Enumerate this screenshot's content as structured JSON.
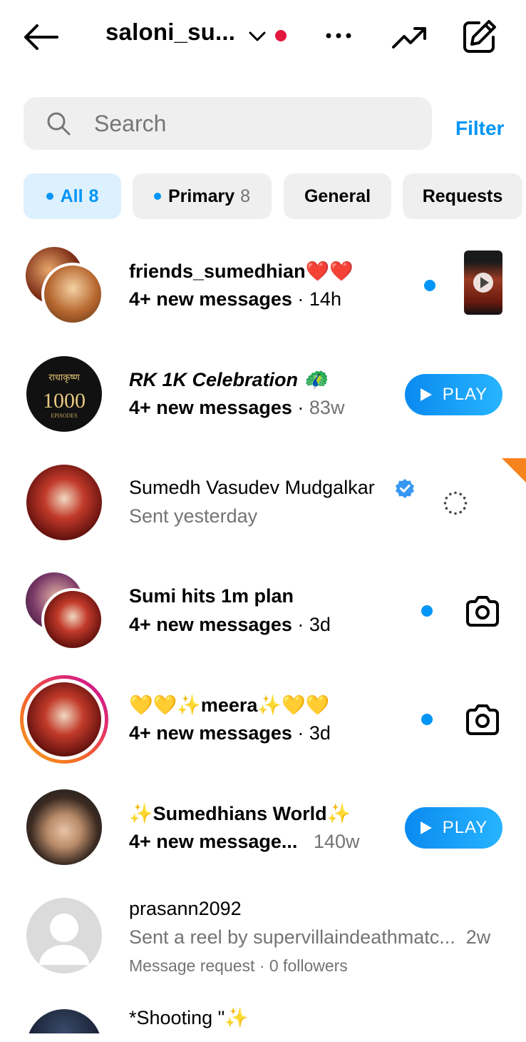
{
  "header": {
    "username": "saloni_su...",
    "icons": [
      "arrow-left-icon",
      "chevron-down-icon",
      "more-horizontal-icon",
      "trending-icon",
      "compose-icon"
    ]
  },
  "search": {
    "placeholder": "Search",
    "filter_label": "Filter"
  },
  "tabs": [
    {
      "label": "All",
      "count": "8",
      "active": true
    },
    {
      "label": "Primary",
      "count": "8"
    },
    {
      "label": "General"
    },
    {
      "label": "Requests"
    }
  ],
  "threads": [
    {
      "name": "friends_sumedhian❤️❤️",
      "preview": "4+ new messages",
      "time": "14h",
      "unread": true,
      "trailing": "video-thumbnail"
    },
    {
      "name": "RK 1K Celebration 🦚",
      "avatar_text": "राधाकृष्ण 1000 EPISODES",
      "preview": "4+ new messages",
      "time": "83w",
      "unread": false,
      "trailing": "play",
      "play_label": "PLAY"
    },
    {
      "name": "Sumedh Vasudev Mudgalkar",
      "verified": true,
      "preview": "Sent yesterday",
      "trailing": "loading-spinner"
    },
    {
      "name": "Sumi hits 1m plan",
      "preview": "4+ new messages",
      "time": "3d",
      "unread": true,
      "trailing": "camera"
    },
    {
      "name": "💛💛✨meera✨💛💛",
      "preview": "4+ new messages",
      "time": "3d",
      "unread": true,
      "trailing": "camera",
      "story_ring": true
    },
    {
      "name": "✨Sumedhians World✨",
      "preview": "4+ new message...",
      "time": "140w",
      "trailing": "play",
      "play_label": "PLAY"
    },
    {
      "name": "prasann2092",
      "preview": "Sent a reel by supervillaindeathmatc...",
      "time": "2w",
      "meta": "Message request · 0 followers"
    },
    {
      "name": "*Shooting \"✨"
    }
  ],
  "colors": {
    "accent": "#0095f6",
    "unread_dot": "#e4173e",
    "ring_start": "#f9a21b",
    "ring_end": "#c9089e"
  }
}
